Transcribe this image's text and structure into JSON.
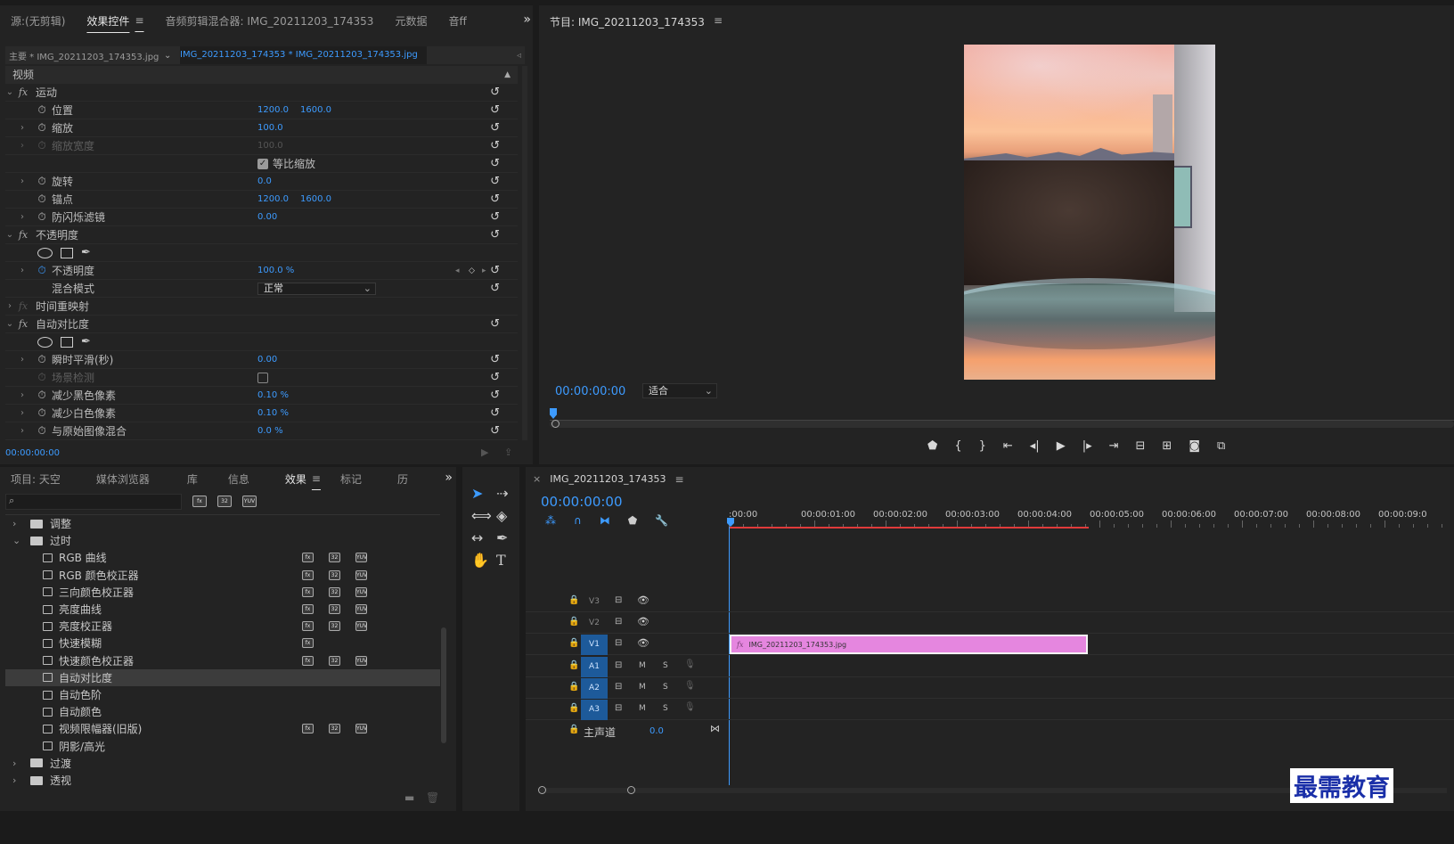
{
  "effect_controls": {
    "tabs": [
      {
        "label": "源:(无剪辑)"
      },
      {
        "label": "效果控件"
      },
      {
        "label": "音频剪辑混合器: IMG_20211203_174353"
      },
      {
        "label": "元数据"
      },
      {
        "label": "音ff"
      }
    ],
    "master_clip": "主要 * IMG_20211203_174353.jpg",
    "seq_clip": "IMG_20211203_174353 * IMG_20211203_174353.jpg",
    "section": "视频",
    "motion": {
      "name": "运动",
      "position": {
        "label": "位置",
        "x": "1200.0",
        "y": "1600.0"
      },
      "scale": {
        "label": "缩放",
        "value": "100.0"
      },
      "scale_width": {
        "label": "缩放宽度",
        "value": "100.0"
      },
      "uniform": "等比缩放",
      "rotation": {
        "label": "旋转",
        "value": "0.0"
      },
      "anchor": {
        "label": "锚点",
        "x": "1200.0",
        "y": "1600.0"
      },
      "flicker": {
        "label": "防闪烁滤镜",
        "value": "0.00"
      }
    },
    "opacity": {
      "name": "不透明度",
      "opacity": {
        "label": "不透明度",
        "value": "100.0 %"
      },
      "blend": {
        "label": "混合模式",
        "value": "正常"
      }
    },
    "time_remap": "时间重映射",
    "auto_contrast": {
      "name": "自动对比度",
      "smooth": {
        "label": "瞬时平滑(秒)",
        "value": "0.00"
      },
      "scene": {
        "label": "场景检测"
      },
      "black": {
        "label": "减少黑色像素",
        "value": "0.10 %"
      },
      "white": {
        "label": "减少白色像素",
        "value": "0.10 %"
      },
      "blend": {
        "label": "与原始图像混合",
        "value": "0.0 %"
      }
    },
    "timecode": "00:00:00:00"
  },
  "program": {
    "title": "节目: IMG_20211203_174353",
    "timecode": "00:00:00:00",
    "fit": "适合"
  },
  "project": {
    "tabs": [
      {
        "label": "项目: 天空"
      },
      {
        "label": "媒体浏览器"
      },
      {
        "label": "库"
      },
      {
        "label": "信息"
      },
      {
        "label": "效果"
      },
      {
        "label": "标记"
      },
      {
        "label": "历"
      }
    ],
    "items": [
      {
        "label": "调整",
        "type": "folder",
        "open": false,
        "badges": 0
      },
      {
        "label": "过时",
        "type": "folder",
        "open": true,
        "badges": 0
      },
      {
        "label": "RGB 曲线",
        "type": "fx",
        "badges": 3
      },
      {
        "label": "RGB 颜色校正器",
        "type": "fx",
        "badges": 3
      },
      {
        "label": "三向颜色校正器",
        "type": "fx",
        "badges": 3
      },
      {
        "label": "亮度曲线",
        "type": "fx",
        "badges": 3
      },
      {
        "label": "亮度校正器",
        "type": "fx",
        "badges": 3
      },
      {
        "label": "快速模糊",
        "type": "fx",
        "badges": 1
      },
      {
        "label": "快速颜色校正器",
        "type": "fx",
        "badges": 3
      },
      {
        "label": "自动对比度",
        "type": "fx",
        "badges": 0,
        "selected": true
      },
      {
        "label": "自动色阶",
        "type": "fx",
        "badges": 0
      },
      {
        "label": "自动颜色",
        "type": "fx",
        "badges": 0
      },
      {
        "label": "视频限幅器(旧版)",
        "type": "fx",
        "badges": 3
      },
      {
        "label": "阴影/高光",
        "type": "fx",
        "badges": 0
      },
      {
        "label": "过渡",
        "type": "folder",
        "open": false,
        "badges": 0
      },
      {
        "label": "透视",
        "type": "folder",
        "open": false,
        "badges": 0
      }
    ],
    "badge_labels": [
      "fx",
      "32",
      "YUV"
    ]
  },
  "timeline": {
    "title": "IMG_20211203_174353",
    "timecode": "00:00:00:00",
    "ruler": [
      ":00:00",
      "00:00:01:00",
      "00:00:02:00",
      "00:00:03:00",
      "00:00:04:00",
      "00:00:05:00",
      "00:00:06:00",
      "00:00:07:00",
      "00:00:08:00",
      "00:00:09:0"
    ],
    "video_tracks": [
      "V3",
      "V2",
      "V1"
    ],
    "audio_tracks": [
      "A1",
      "A2",
      "A3"
    ],
    "master": {
      "label": "主声道",
      "value": "0.0"
    },
    "clip": {
      "name": "IMG_20211203_174353.jpg",
      "color": "#e586df"
    }
  },
  "watermark": "最需教育"
}
